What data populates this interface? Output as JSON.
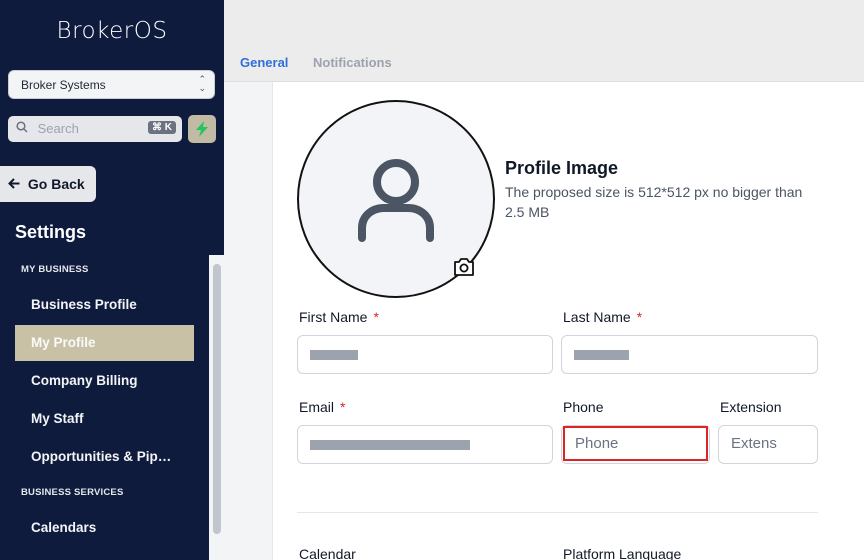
{
  "sidebar": {
    "brand": "BrokerOS",
    "account": "Broker Systems",
    "search_placeholder": "Search",
    "search_shortcut": "⌘ K",
    "go_back": "Go Back",
    "settings_title": "Settings",
    "sections": [
      {
        "label": "MY BUSINESS"
      },
      {
        "label": "BUSINESS SERVICES"
      }
    ],
    "items": [
      {
        "label": "Business Profile",
        "active": false
      },
      {
        "label": "My Profile",
        "active": true
      },
      {
        "label": "Company Billing",
        "active": false
      },
      {
        "label": "My Staff",
        "active": false
      },
      {
        "label": "Opportunities & Pipelines",
        "active": false
      },
      {
        "label": "Calendars",
        "active": false
      }
    ]
  },
  "tabs": [
    {
      "label": "General",
      "active": true
    },
    {
      "label": "Notifications",
      "active": false
    }
  ],
  "profile_image": {
    "title": "Profile Image",
    "description": "The proposed size is 512*512 px no bigger than 2.5 MB"
  },
  "form": {
    "first_name": {
      "label": "First Name",
      "required_mark": "*"
    },
    "last_name": {
      "label": "Last Name",
      "required_mark": "*"
    },
    "email": {
      "label": "Email",
      "required_mark": "*"
    },
    "phone": {
      "label": "Phone",
      "placeholder": "Phone"
    },
    "extension": {
      "label": "Extension",
      "placeholder": "Extens"
    },
    "calendar": {
      "label": "Calendar"
    },
    "platform_language": {
      "label": "Platform Language"
    }
  },
  "colors": {
    "sidebar_bg": "#0e1b3d",
    "active_item": "#c9c1a6",
    "tab_active": "#2f6fd8",
    "required": "#dc2626",
    "bolt": "#22c55e"
  }
}
